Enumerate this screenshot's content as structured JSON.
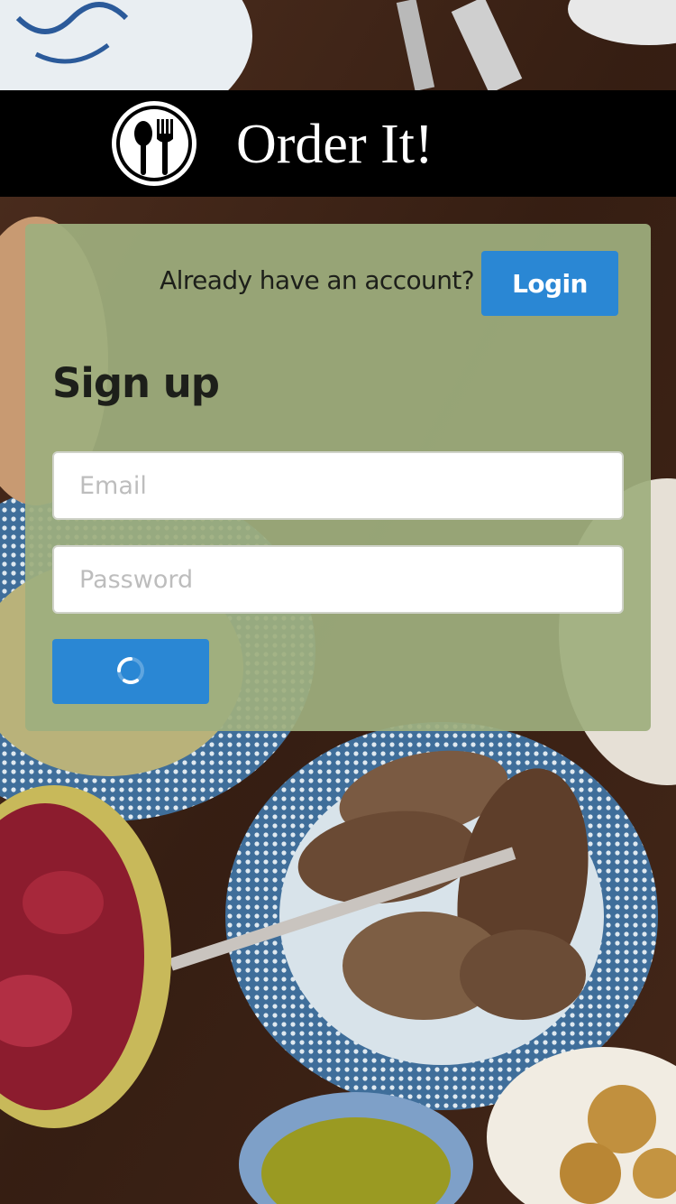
{
  "app": {
    "title": "Order It!",
    "logo_icon": "fork-spoon-icon"
  },
  "auth": {
    "prompt": "Already have an account?",
    "login_label": "Login",
    "heading": "Sign up",
    "email_placeholder": "Email",
    "password_placeholder": "Password",
    "email_value": "",
    "password_value": "",
    "submit_state": "loading",
    "submit_icon": "spinner-icon"
  },
  "colors": {
    "header_bg": "#000000",
    "card_bg": "#9eae7e",
    "button_blue": "#2a87d4"
  }
}
